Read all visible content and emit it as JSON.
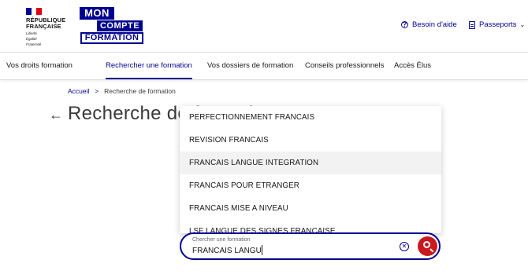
{
  "header": {
    "republique": [
      "RÉPUBLIQUE",
      "FRANÇAISE"
    ],
    "motto": [
      "Liberté",
      "Égalité",
      "Fraternité"
    ],
    "logo": {
      "line1": "MON",
      "line2": "COMPTE",
      "line3": "FORMATION"
    },
    "links": [
      {
        "label": "Besoin d'aide",
        "icon": "help-circle-icon"
      },
      {
        "label": "Passeports",
        "icon": "document-icon"
      }
    ]
  },
  "nav": {
    "items": [
      {
        "label": "Vos droits formation",
        "active": false
      },
      {
        "label": "Rechercher une formation",
        "active": true
      },
      {
        "label": "Vos dossiers de formation",
        "active": false
      },
      {
        "label": "Conseils professionnels",
        "active": false
      },
      {
        "label": "Accès Élus",
        "active": false
      }
    ]
  },
  "breadcrumb": {
    "home": "Accueil",
    "current": "Recherche de formation"
  },
  "title": "Recherche de formation",
  "suggestions": [
    "PERFECTIONNEMENT FRANCAIS",
    "REVISION FRANCAIS",
    "FRANCAIS LANGUE INTEGRATION",
    "FRANCAIS POUR ETRANGER",
    "FRANCAIS MISE A NIVEAU",
    "LSF LANGUE DES SIGNES FRANCAISE"
  ],
  "search": {
    "label": "Chercher une formation",
    "value": "FRANCAIS LANGU"
  },
  "colors": {
    "primary": "#000091",
    "accent": "#c9191e",
    "highlight": "#f2f2f2"
  }
}
